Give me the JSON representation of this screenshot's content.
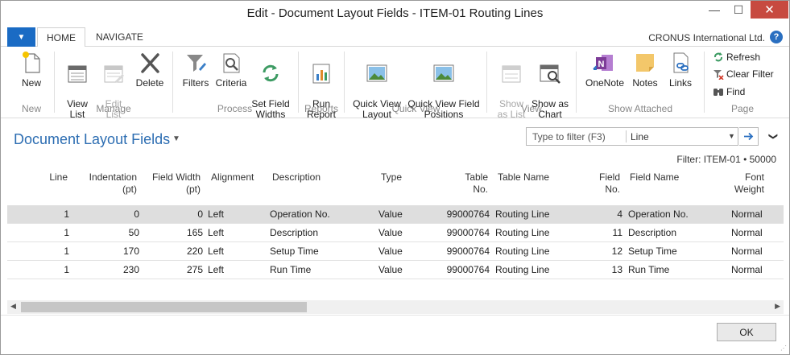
{
  "window": {
    "title": "Edit - Document Layout Fields - ITEM-01 Routing Lines",
    "minimize_glyph": "—",
    "maximize_glyph": "☐",
    "close_glyph": "✕"
  },
  "ribbon_tabs": {
    "app_menu_glyph": "▼",
    "tabs": [
      {
        "label": "HOME"
      },
      {
        "label": "NAVIGATE"
      }
    ],
    "company": "CRONUS International Ltd.",
    "help_glyph": "?"
  },
  "ribbon": {
    "new": {
      "label": "New",
      "group": "New"
    },
    "view_list": {
      "label": "View\nList"
    },
    "edit_list": {
      "label": "Edit\nList"
    },
    "delete": {
      "label": "Delete"
    },
    "manage_group": "Manage",
    "filters": {
      "label": "Filters"
    },
    "criteria": {
      "label": "Criteria"
    },
    "set_field_widths": {
      "label": "Set Field\nWidths"
    },
    "process_group": "Process",
    "run_report": {
      "label": "Run\nReport"
    },
    "reports_group": "Reports",
    "quick_view_layout": {
      "label": "Quick View\nLayout"
    },
    "quick_view_field_positions": {
      "label": "Quick View Field\nPositions"
    },
    "quick_view_group": "Quick View",
    "show_as_list": {
      "label": "Show\nas List"
    },
    "show_as_chart": {
      "label": "Show as\nChart"
    },
    "view_group": "View",
    "onenote": {
      "label": "OneNote"
    },
    "notes": {
      "label": "Notes"
    },
    "links": {
      "label": "Links"
    },
    "show_attached_group": "Show Attached",
    "refresh": {
      "label": "Refresh"
    },
    "clear_filter": {
      "label": "Clear Filter"
    },
    "find": {
      "label": "Find"
    },
    "page_group": "Page"
  },
  "page": {
    "title": "Document Layout Fields",
    "title_caret": "▼",
    "filter_placeholder": "Type to filter (F3)",
    "filter_field": "Line",
    "filter_info": "Filter: ITEM-01 • 50000",
    "collapse_glyph": "❯"
  },
  "table": {
    "columns": [
      {
        "key": "line",
        "label": "Line"
      },
      {
        "key": "indentation",
        "label": "Indentation\n(pt)"
      },
      {
        "key": "field_width",
        "label": "Field Width\n(pt)"
      },
      {
        "key": "alignment",
        "label": "Alignment"
      },
      {
        "key": "description",
        "label": "Description"
      },
      {
        "key": "type",
        "label": "Type"
      },
      {
        "key": "table_no",
        "label": "Table\nNo."
      },
      {
        "key": "table_name",
        "label": "Table Name"
      },
      {
        "key": "field_no",
        "label": "Field\nNo."
      },
      {
        "key": "field_name",
        "label": "Field Name"
      },
      {
        "key": "font_weight",
        "label": "Font\nWeight"
      }
    ],
    "rows": [
      {
        "line": "1",
        "indentation": "0",
        "field_width": "0",
        "alignment": "Left",
        "description": "Operation No.",
        "type": "Value",
        "table_no": "99000764",
        "table_name": "Routing Line",
        "field_no": "4",
        "field_name": "Operation No.",
        "font_weight": "Normal"
      },
      {
        "line": "1",
        "indentation": "50",
        "field_width": "165",
        "alignment": "Left",
        "description": "Description",
        "type": "Value",
        "table_no": "99000764",
        "table_name": "Routing Line",
        "field_no": "11",
        "field_name": "Description",
        "font_weight": "Normal"
      },
      {
        "line": "1",
        "indentation": "170",
        "field_width": "220",
        "alignment": "Left",
        "description": "Setup Time",
        "type": "Value",
        "table_no": "99000764",
        "table_name": "Routing Line",
        "field_no": "12",
        "field_name": "Setup Time",
        "font_weight": "Normal"
      },
      {
        "line": "1",
        "indentation": "230",
        "field_width": "275",
        "alignment": "Left",
        "description": "Run Time",
        "type": "Value",
        "table_no": "99000764",
        "table_name": "Routing Line",
        "field_no": "13",
        "field_name": "Run Time",
        "font_weight": "Normal"
      }
    ],
    "selected_row": 0
  },
  "scrollbar": {
    "left_glyph": "◀",
    "right_glyph": "▶"
  },
  "footer": {
    "ok_label": "OK",
    "grip_glyph": "⋰"
  },
  "colors": {
    "accent": "#2c6db2",
    "app_menu": "#1a6bc4",
    "close": "#c74a40",
    "selected_row": "#dedede"
  }
}
